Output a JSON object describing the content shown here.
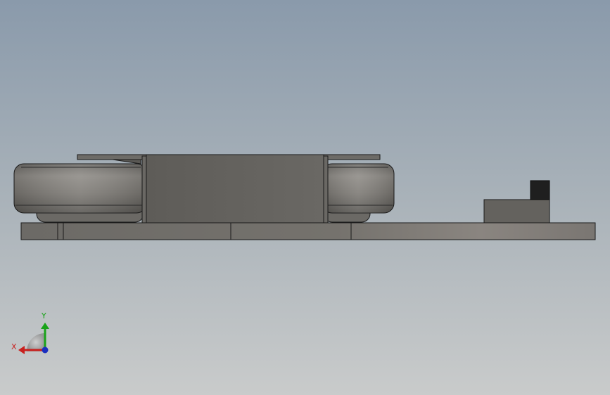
{
  "window": {
    "title": ""
  },
  "scene": {
    "background_top": "#8a9aab",
    "background_bottom": "#c9cbcb",
    "edge_color": "#1a1a1a",
    "colors": {
      "roller": "#8c8984",
      "roller_dark": "#5f5c58",
      "carriage": "#666560",
      "rail": "#7a7772",
      "block": "#64625e",
      "sensor": "#1f1f1f"
    }
  },
  "triad": {
    "x_label": "X",
    "y_label": "Y",
    "x_color": "#c8201e",
    "y_color": "#19a319",
    "z_color": "#1b2fbf"
  }
}
